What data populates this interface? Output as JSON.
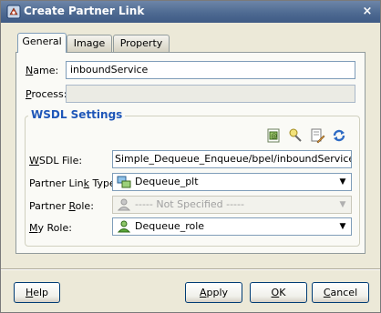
{
  "window": {
    "title": "Create Partner Link",
    "title_icon": "oracle-jdev-icon",
    "close_label": "×"
  },
  "tabs": [
    {
      "label": "General",
      "active": true
    },
    {
      "label": "Image",
      "active": false
    },
    {
      "label": "Property",
      "active": false
    }
  ],
  "form": {
    "name_label_ul": "N",
    "name_label_rest": "ame:",
    "name_value": "inboundService",
    "process_label_ul": "P",
    "process_label_rest": "rocess:",
    "process_value": ""
  },
  "wsdl": {
    "group_title": "WSDL Settings",
    "toolbar_icons": [
      "service-explorer-icon",
      "wizard-icon",
      "edit-wsdl-icon",
      "refresh-icon"
    ],
    "file_label_ul": "W",
    "file_label_rest": "SDL File:",
    "file_value": "Simple_Dequeue_Enqueue/bpel/inboundService.wsdl",
    "plt_label_pre": "Partner Lin",
    "plt_label_ul": "k",
    "plt_label_post": " Type:",
    "plt_value": "Dequeue_plt",
    "partner_role_label_pre": "Partner ",
    "partner_role_label_ul": "R",
    "partner_role_label_post": "ole:",
    "partner_role_value": "----- Not Specified -----",
    "my_role_label_ul": "M",
    "my_role_label_rest": "y Role:",
    "my_role_value": "Dequeue_role"
  },
  "buttons": {
    "help_ul": "H",
    "help_rest": "elp",
    "apply_ul": "A",
    "apply_rest": "pply",
    "ok_ul": "O",
    "ok_rest": "K",
    "cancel_ul": "C",
    "cancel_rest": "ancel"
  },
  "colors": {
    "titlebar": "#4e6a92",
    "group_title": "#1e56b8",
    "dialog_bg": "#ece9d8"
  }
}
